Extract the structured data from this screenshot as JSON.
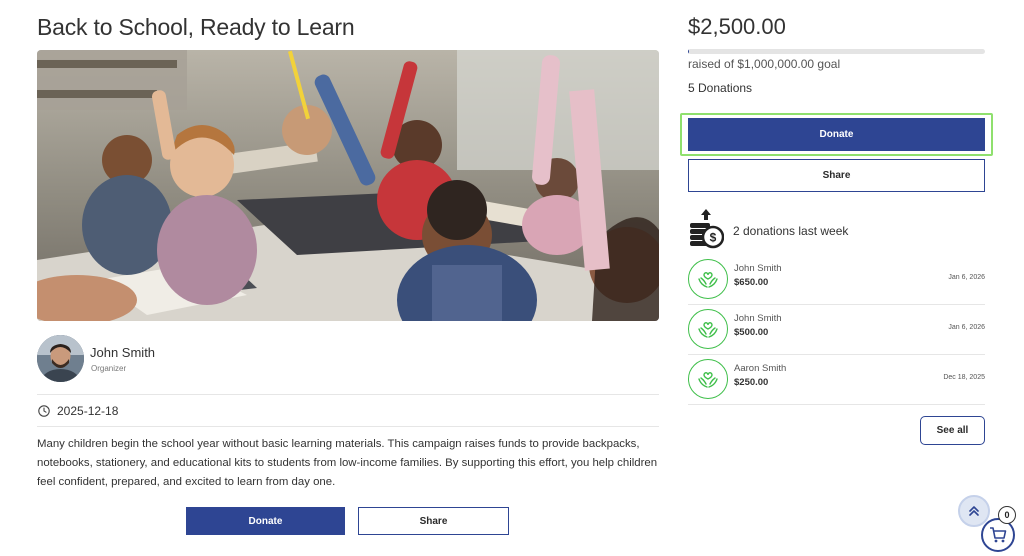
{
  "campaign": {
    "title": "Back to School, Ready to Learn",
    "organizer_name": "John Smith",
    "organizer_role": "Organizer",
    "date": "2025-12-18",
    "description": "Many children begin the school year without basic learning materials. This campaign raises funds to provide backpacks, notebooks, stationery, and educational kits to students from low-income families. By supporting this effort, you help children feel confident, prepared, and excited to learn from day one.",
    "donate_label": "Donate",
    "share_label": "Share"
  },
  "summary": {
    "raised": "$2,500.00",
    "goal_text": "raised of $1,000,000.00 goal",
    "progress_fraction": 0.0025,
    "donation_count": "5 Donations",
    "donate_label": "Donate",
    "share_label": "Share",
    "week_text": "2 donations last week"
  },
  "donations": [
    {
      "name": "John Smith",
      "amount": "$650.00",
      "date": "Jan 6, 2026"
    },
    {
      "name": "John Smith",
      "amount": "$500.00",
      "date": "Jan 6, 2026"
    },
    {
      "name": "Aaron Smith",
      "amount": "$250.00",
      "date": "Dec 18, 2025"
    }
  ],
  "see_all_label": "See all",
  "cart": {
    "count": "0"
  },
  "icons": {
    "clock": "clock-icon",
    "coins": "coins-stack-icon",
    "donation": "hands-heart-icon",
    "scroll_top": "double-chevron-up-icon",
    "cart": "shopping-cart-icon"
  },
  "colors": {
    "primary": "#2e4593",
    "accent_green": "#3fbf4a",
    "focus_ring": "#8fe06e"
  }
}
